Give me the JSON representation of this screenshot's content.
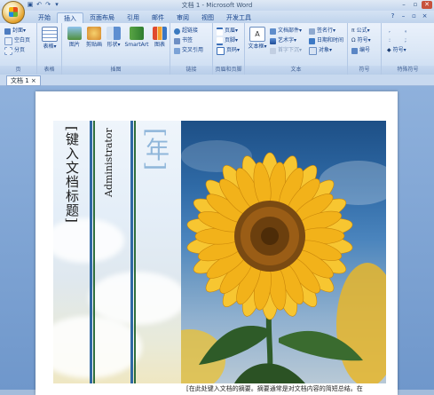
{
  "window": {
    "title": "文档 1 - Microsoft Word"
  },
  "tabs": [
    "开始",
    "插入",
    "页面布局",
    "引用",
    "邮件",
    "审阅",
    "视图",
    "开发工具"
  ],
  "active_tab": "插入",
  "ribbon": {
    "pages": {
      "label": "页",
      "items": [
        "封面",
        "空白页",
        "分页"
      ]
    },
    "tables": {
      "label": "表格",
      "button": "表格"
    },
    "illustrations": {
      "label": "插图",
      "buttons": [
        "图片",
        "剪贴画",
        "形状",
        "SmartArt",
        "图表"
      ]
    },
    "links": {
      "label": "链接",
      "items": [
        "超链接",
        "书签",
        "交叉引用"
      ]
    },
    "header_footer": {
      "label": "页眉和页脚",
      "items": [
        "页眉",
        "页脚",
        "页码"
      ]
    },
    "text": {
      "label": "文本",
      "textbox": "文本框",
      "items_col1": [
        "文档部件",
        "艺术字",
        "首字下沉"
      ],
      "items_col2": [
        "签名行",
        "日期和时间",
        "对象"
      ]
    },
    "symbols": {
      "label": "符号",
      "items": [
        "公式",
        "符号",
        "编号"
      ]
    },
    "special": {
      "label": "特殊符号",
      "items": [
        ",",
        ":",
        "符号"
      ],
      "extra": [
        "。",
        ";"
      ]
    }
  },
  "doc_tab": "文档 1",
  "cover": {
    "title": "[键入文档标题]",
    "author": "Administrator",
    "year": "[年]",
    "summary": "[在此处键入文档的摘要。摘要通常是对文档内容的简短总结。在"
  },
  "colors": {
    "stripe_blue": "#2f68a4",
    "stripe_green": "#2f6e3c",
    "year_text": "#8fb6da",
    "ribbon_text": "#15428b"
  }
}
